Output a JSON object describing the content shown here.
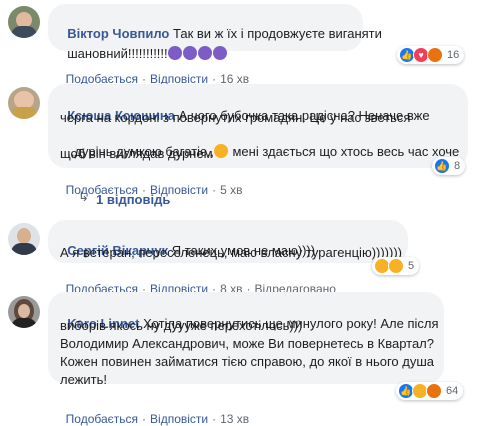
{
  "comments": [
    {
      "author": "Віктор Човпило",
      "lines": [
        "Так ви ж їх і продовжуєте виганяти",
        "шановний!!!!!!!!!!!"
      ],
      "reactions_count": "16",
      "actions": {
        "like": "Подобається",
        "reply": "Відповісти",
        "time": "16 хв"
      }
    },
    {
      "author": "Ксюша Ксюшина",
      "lines": [
        "А чого бубочка така радісна? Неначе вже",
        "черга на кордоні з повернутих громадян. Це у нас зветься",
        ",,дурінь думкою багатіє,,",
        " мені здається що хтось весь час хоче",
        "щоб він виглядав дурнем"
      ],
      "reactions_count": "8",
      "actions": {
        "like": "Подобається",
        "reply": "Відповісти",
        "time": "5 хв"
      }
    },
    {
      "author": "Сергій Вікарчук",
      "lines": [
        "Я таких умов не маю))))",
        "А я ветеран, переселенець, маю власну турагенцію)))))))"
      ],
      "reactions_count": "5",
      "actions": {
        "like": "Подобається",
        "reply": "Відповісти",
        "time": "8 хв",
        "edited": "Відредаговано"
      }
    },
    {
      "author": "Karo Linnet",
      "lines": [
        "Хотіла повернутись ще минулого року! Але після",
        "виборів якось ну дуууже перехотілось)))",
        "Володимир Александрович, може Ви повернетесь в Квартал?",
        "Кожен повинен займатися тією справою, до якої в нього душа",
        "лежить!"
      ],
      "reactions_count": "64",
      "actions": {
        "like": "Подобається",
        "reply": "Відповісти",
        "time": "13 хв"
      }
    }
  ],
  "replies_link": "1 відповідь",
  "colors": {
    "link": "#385898",
    "bubble": "#f2f3f5",
    "meta": "#606770"
  }
}
